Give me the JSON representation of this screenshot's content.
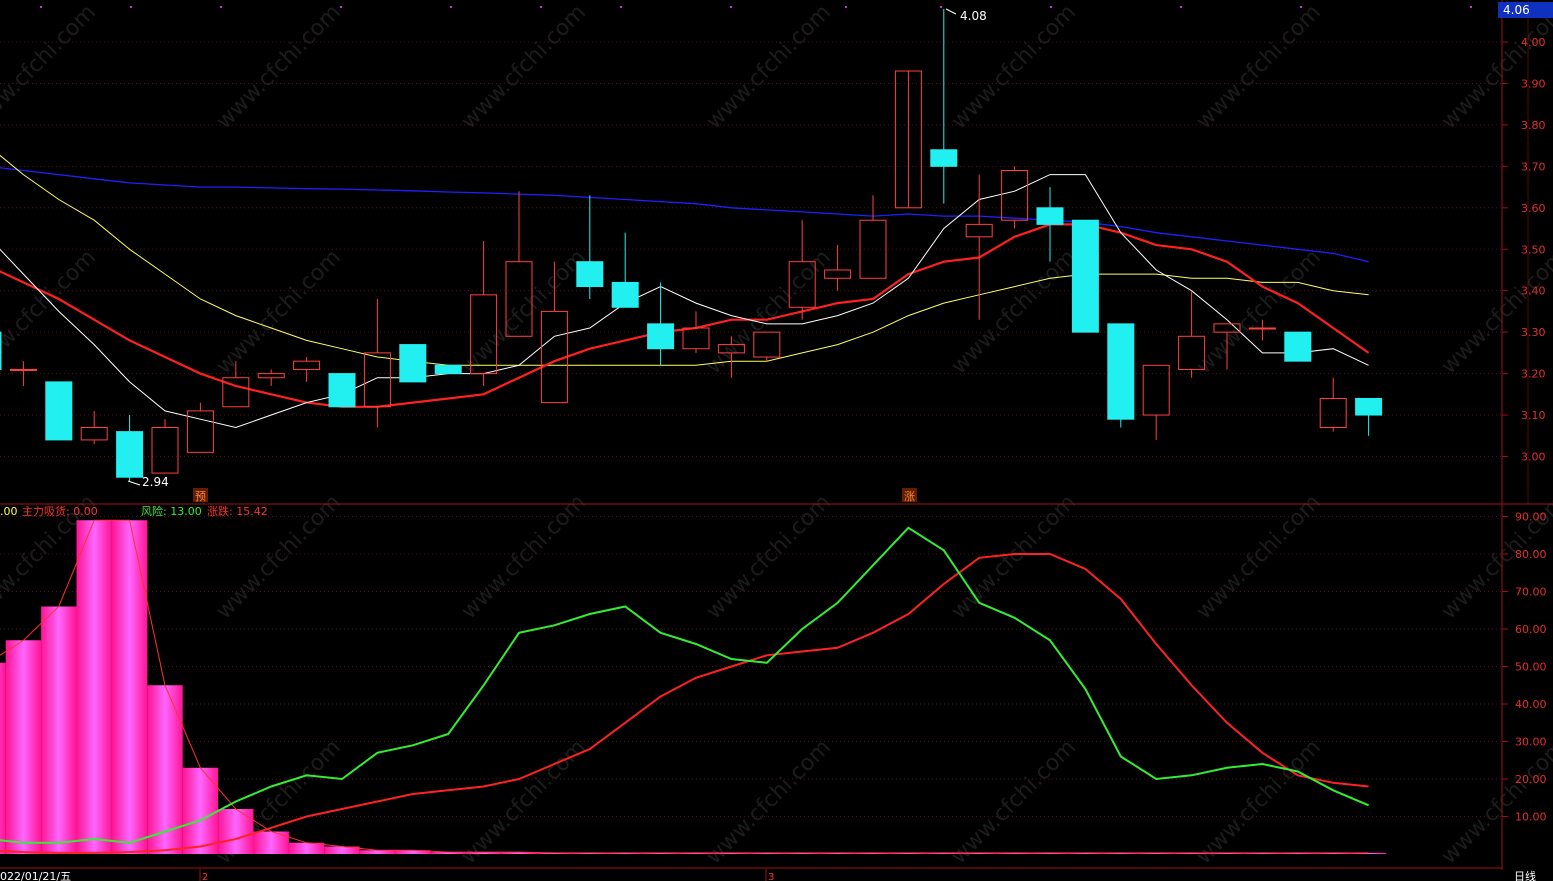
{
  "colors": {
    "background": "#000000",
    "frame": "#a01010",
    "up": "#ff4040",
    "down": "#22f0f0",
    "ma5": "#ffffff",
    "ma10": "#ff2020",
    "ma20": "#ffff60",
    "ma60": "#2020ff",
    "risk": "#33ee33",
    "rise": "#ff2222",
    "accum_main": "#ff33cc",
    "accum_edge": "#ff1010"
  },
  "watermark_text": "www.cfchi.com",
  "price_panel": {
    "current_price_box": "4.06",
    "y_ticks": [
      "4.00",
      "3.90",
      "3.80",
      "3.70",
      "3.60",
      "3.50",
      "3.40",
      "3.30",
      "3.20",
      "3.10",
      "3.00"
    ],
    "high_label": "4.08",
    "low_label": "2.94",
    "marker_left": "预",
    "marker_mid": "涨"
  },
  "indicator_panel": {
    "legend_prefix": ".00",
    "legend_main_label": "主力吸货: 0.00",
    "legend_risk_label": "风险: 13.00",
    "legend_rise_label": "涨跌: 15.42",
    "y_ticks": [
      "90.00",
      "80.00",
      "70.00",
      "60.00",
      "50.00",
      "40.00",
      "30.00",
      "20.00",
      "10.00"
    ]
  },
  "bottom_bar": {
    "date_label": "022/01/21/五",
    "marker_2": "2",
    "marker_3": "3",
    "period_label": "日线"
  },
  "chart_data": [
    {
      "type": "candlestick",
      "ylim": [
        2.9,
        4.1
      ],
      "candles": [
        {
          "o": 3.3,
          "h": 3.33,
          "l": 3.2,
          "c": 3.21
        },
        {
          "o": 3.21,
          "h": 3.23,
          "l": 3.17,
          "c": 3.21
        },
        {
          "o": 3.18,
          "h": 3.18,
          "l": 3.04,
          "c": 3.04
        },
        {
          "o": 3.04,
          "h": 3.11,
          "l": 3.03,
          "c": 3.07
        },
        {
          "o": 3.06,
          "h": 3.1,
          "l": 2.94,
          "c": 2.95
        },
        {
          "o": 2.96,
          "h": 3.09,
          "l": 2.96,
          "c": 3.07
        },
        {
          "o": 3.01,
          "h": 3.13,
          "l": 3.01,
          "c": 3.11
        },
        {
          "o": 3.12,
          "h": 3.23,
          "l": 3.12,
          "c": 3.19
        },
        {
          "o": 3.19,
          "h": 3.21,
          "l": 3.17,
          "c": 3.2
        },
        {
          "o": 3.21,
          "h": 3.24,
          "l": 3.18,
          "c": 3.23
        },
        {
          "o": 3.2,
          "h": 3.2,
          "l": 3.12,
          "c": 3.12
        },
        {
          "o": 3.12,
          "h": 3.38,
          "l": 3.07,
          "c": 3.25
        },
        {
          "o": 3.27,
          "h": 3.27,
          "l": 3.18,
          "c": 3.18
        },
        {
          "o": 3.22,
          "h": 3.22,
          "l": 3.2,
          "c": 3.2
        },
        {
          "o": 3.2,
          "h": 3.52,
          "l": 3.17,
          "c": 3.39
        },
        {
          "o": 3.29,
          "h": 3.64,
          "l": 3.29,
          "c": 3.47
        },
        {
          "o": 3.13,
          "h": 3.47,
          "l": 3.13,
          "c": 3.35
        },
        {
          "o": 3.47,
          "h": 3.63,
          "l": 3.38,
          "c": 3.41
        },
        {
          "o": 3.42,
          "h": 3.54,
          "l": 3.36,
          "c": 3.36
        },
        {
          "o": 3.32,
          "h": 3.42,
          "l": 3.22,
          "c": 3.26
        },
        {
          "o": 3.26,
          "h": 3.35,
          "l": 3.25,
          "c": 3.31
        },
        {
          "o": 3.25,
          "h": 3.29,
          "l": 3.19,
          "c": 3.27
        },
        {
          "o": 3.24,
          "h": 3.3,
          "l": 3.23,
          "c": 3.3
        },
        {
          "o": 3.36,
          "h": 3.57,
          "l": 3.33,
          "c": 3.47
        },
        {
          "o": 3.43,
          "h": 3.51,
          "l": 3.4,
          "c": 3.45
        },
        {
          "o": 3.43,
          "h": 3.63,
          "l": 3.43,
          "c": 3.57
        },
        {
          "o": 3.6,
          "h": 3.6,
          "l": 3.6,
          "c": 3.93
        },
        {
          "o": 3.74,
          "h": 4.08,
          "l": 3.61,
          "c": 3.7
        },
        {
          "o": 3.53,
          "h": 3.68,
          "l": 3.33,
          "c": 3.56
        },
        {
          "o": 3.57,
          "h": 3.7,
          "l": 3.55,
          "c": 3.69
        },
        {
          "o": 3.6,
          "h": 3.65,
          "l": 3.47,
          "c": 3.56
        },
        {
          "o": 3.57,
          "h": 3.57,
          "l": 3.3,
          "c": 3.3
        },
        {
          "o": 3.32,
          "h": 3.32,
          "l": 3.07,
          "c": 3.09
        },
        {
          "o": 3.1,
          "h": 3.22,
          "l": 3.04,
          "c": 3.22
        },
        {
          "o": 3.21,
          "h": 3.4,
          "l": 3.19,
          "c": 3.29
        },
        {
          "o": 3.3,
          "h": 3.32,
          "l": 3.21,
          "c": 3.32
        },
        {
          "o": 3.31,
          "h": 3.33,
          "l": 3.28,
          "c": 3.31
        },
        {
          "o": 3.3,
          "h": 3.3,
          "l": 3.23,
          "c": 3.23
        },
        {
          "o": 3.07,
          "h": 3.19,
          "l": 3.06,
          "c": 3.14
        },
        {
          "o": 3.14,
          "h": 3.14,
          "l": 3.05,
          "c": 3.1
        }
      ],
      "ma5": [
        3.53,
        3.44,
        3.35,
        3.27,
        3.18,
        3.11,
        3.09,
        3.07,
        3.1,
        3.13,
        3.15,
        3.19,
        3.19,
        3.2,
        3.2,
        3.22,
        3.29,
        3.31,
        3.37,
        3.41,
        3.37,
        3.34,
        3.32,
        3.32,
        3.34,
        3.37,
        3.43,
        3.55,
        3.62,
        3.64,
        3.68,
        3.68,
        3.54,
        3.45,
        3.4,
        3.33,
        3.25,
        3.25,
        3.26,
        3.22
      ],
      "ma10": [
        3.46,
        3.42,
        3.38,
        3.33,
        3.28,
        3.24,
        3.2,
        3.17,
        3.15,
        3.13,
        3.12,
        3.12,
        3.13,
        3.14,
        3.15,
        3.19,
        3.23,
        3.26,
        3.28,
        3.3,
        3.31,
        3.33,
        3.33,
        3.35,
        3.37,
        3.38,
        3.44,
        3.47,
        3.48,
        3.53,
        3.56,
        3.56,
        3.54,
        3.51,
        3.5,
        3.47,
        3.41,
        3.37,
        3.31,
        3.25
      ],
      "ma20": [
        3.75,
        3.68,
        3.62,
        3.57,
        3.5,
        3.44,
        3.38,
        3.34,
        3.31,
        3.28,
        3.26,
        3.24,
        3.23,
        3.22,
        3.22,
        3.22,
        3.22,
        3.22,
        3.22,
        3.22,
        3.22,
        3.23,
        3.23,
        3.25,
        3.27,
        3.3,
        3.34,
        3.37,
        3.39,
        3.41,
        3.43,
        3.44,
        3.44,
        3.44,
        3.43,
        3.43,
        3.42,
        3.42,
        3.4,
        3.39
      ],
      "ma60": [
        3.7,
        3.69,
        3.68,
        3.67,
        3.66,
        3.655,
        3.65,
        3.65,
        3.648,
        3.646,
        3.645,
        3.643,
        3.641,
        3.638,
        3.636,
        3.633,
        3.63,
        3.625,
        3.62,
        3.615,
        3.61,
        3.6,
        3.595,
        3.59,
        3.585,
        3.58,
        3.585,
        3.58,
        3.58,
        3.575,
        3.57,
        3.565,
        3.555,
        3.54,
        3.53,
        3.52,
        3.51,
        3.5,
        3.49,
        3.47
      ]
    },
    {
      "type": "line",
      "ylim": [
        0,
        95
      ],
      "series": [
        {
          "name": "风险",
          "values": [
            4,
            3,
            3,
            4,
            3,
            6,
            9,
            14,
            18,
            21,
            20,
            27,
            29,
            32,
            45,
            59,
            61,
            64,
            66,
            59,
            56,
            52,
            51,
            60,
            67,
            77,
            87,
            81,
            67,
            63,
            57,
            44,
            26,
            20,
            21,
            23,
            24,
            22,
            17,
            13
          ]
        },
        {
          "name": "涨跌",
          "values": [
            1,
            0.5,
            0.3,
            0.3,
            0.5,
            1,
            2,
            4,
            7,
            10,
            12,
            14,
            16,
            17,
            18,
            20,
            24,
            28,
            35,
            42,
            47,
            50,
            53,
            54,
            55,
            59,
            64,
            72,
            79,
            80,
            80,
            76,
            68,
            56,
            45,
            35,
            27,
            21,
            19,
            18
          ]
        },
        {
          "name": "主力吸货",
          "values": [
            51,
            57,
            66,
            89,
            89,
            45,
            23,
            12,
            6,
            3,
            2,
            1,
            1,
            0.5,
            0.5,
            0.5,
            0.3,
            0.3,
            0.3,
            0.3,
            0.3,
            0.3,
            0.3,
            0.3,
            0.3,
            0.3,
            0.3,
            0.3,
            0.3,
            0.3,
            0.3,
            0.3,
            0.3,
            0.3,
            0.3,
            0.3,
            0.3,
            0.3,
            0.3,
            0.3
          ]
        }
      ]
    }
  ]
}
